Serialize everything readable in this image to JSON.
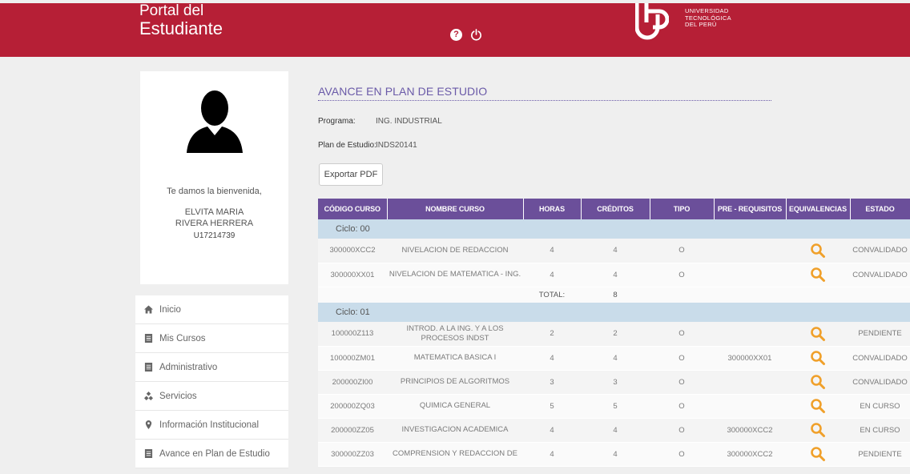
{
  "header": {
    "brand_line1": "Portal del",
    "brand_line2": "Estudiante",
    "logo_line1": "UNIVERSIDAD",
    "logo_line2": "TECNOLÓGICA",
    "logo_line3": "DEL PERÚ",
    "help_glyph": "?"
  },
  "profile": {
    "welcome": "Te damos la bienvenida,",
    "name_line1": "ELVITA MARIA",
    "name_line2": "RIVERA HERRERA",
    "code": "U17214739"
  },
  "menu": [
    {
      "label": "Inicio",
      "icon": "home-icon"
    },
    {
      "label": "Mis Cursos",
      "icon": "document-icon"
    },
    {
      "label": "Administrativo",
      "icon": "document-icon"
    },
    {
      "label": "Servicios",
      "icon": "diamond-icon"
    },
    {
      "label": "Información Institucional",
      "icon": "map-pin-icon"
    },
    {
      "label": "Avance en Plan de Estudio",
      "icon": "document-icon"
    }
  ],
  "main": {
    "title": "AVANCE EN PLAN DE ESTUDIO",
    "programa_label": "Programa:",
    "programa_value": "ING. INDUSTRIAL",
    "plan_label": "Plan de Estudio:",
    "plan_value": "INDS20141",
    "export_label": "Exportar PDF"
  },
  "table": {
    "headers": [
      "CÓDIGO CURSO",
      "NOMBRE CURSO",
      "HORAS",
      "CRÉDITOS",
      "TIPO",
      "PRE - REQUISITOS",
      "EQUIVALENCIAS",
      "ESTADO"
    ],
    "cycles": [
      {
        "label": "Ciclo: 00",
        "rows": [
          {
            "codigo": "300000XCC2",
            "nombre": "NIVELACION DE REDACCION",
            "horas": "4",
            "creditos": "4",
            "tipo": "O",
            "prereq": "",
            "estado": "CONVALIDADO"
          },
          {
            "codigo": "300000XX01",
            "nombre": "NIVELACION DE MATEMATICA - ING.",
            "horas": "4",
            "creditos": "4",
            "tipo": "O",
            "prereq": "",
            "estado": "CONVALIDADO"
          }
        ],
        "total_label": "TOTAL:",
        "total_value": "8"
      },
      {
        "label": "Ciclo: 01",
        "rows": [
          {
            "codigo": "100000Z113",
            "nombre": "INTROD. A LA ING. Y A LOS PROCESOS INDST",
            "horas": "2",
            "creditos": "2",
            "tipo": "O",
            "prereq": "",
            "estado": "PENDIENTE"
          },
          {
            "codigo": "100000ZM01",
            "nombre": "MATEMATICA BASICA I",
            "horas": "4",
            "creditos": "4",
            "tipo": "O",
            "prereq": "300000XX01",
            "estado": "CONVALIDADO"
          },
          {
            "codigo": "200000ZI00",
            "nombre": "PRINCIPIOS DE ALGORITMOS",
            "horas": "3",
            "creditos": "3",
            "tipo": "O",
            "prereq": "",
            "estado": "CONVALIDADO"
          },
          {
            "codigo": "200000ZQ03",
            "nombre": "QUIMICA GENERAL",
            "horas": "5",
            "creditos": "5",
            "tipo": "O",
            "prereq": "",
            "estado": "EN CURSO"
          },
          {
            "codigo": "200000ZZ05",
            "nombre": "INVESTIGACION ACADEMICA",
            "horas": "4",
            "creditos": "4",
            "tipo": "O",
            "prereq": "300000XCC2",
            "estado": "EN CURSO"
          },
          {
            "codigo": "300000ZZ03",
            "nombre": "COMPRENSION Y REDACCION DE",
            "horas": "4",
            "creditos": "4",
            "tipo": "O",
            "prereq": "300000XCC2",
            "estado": "PENDIENTE"
          }
        ]
      }
    ]
  },
  "colors": {
    "header_red": "#b61f36",
    "table_header_purple": "#6b4f9a",
    "title_purple": "#6a5aa8",
    "cycle_blue": "#c9dcea",
    "equivalence_orange": "#f0a02a"
  }
}
